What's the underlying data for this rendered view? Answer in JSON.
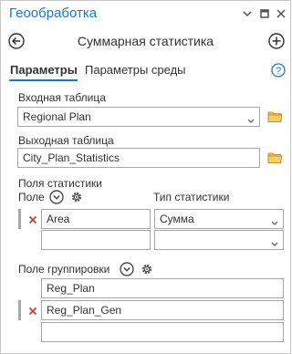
{
  "window": {
    "title": "Геообработка"
  },
  "tool": {
    "title": "Суммарная статистика"
  },
  "tabs": [
    {
      "label": "Параметры"
    },
    {
      "label": "Параметры среды"
    }
  ],
  "input_table": {
    "label": "Входная таблица",
    "value": "Regional Plan"
  },
  "output_table": {
    "label": "Выходная таблица",
    "value": "City_Plan_Statistics"
  },
  "statistics": {
    "section_label": "Поля статистики",
    "field_col_label": "Поле",
    "type_col_label": "Тип статистики",
    "rows": [
      {
        "field": "Area",
        "type": "Сумма"
      },
      {
        "field": "",
        "type": ""
      }
    ]
  },
  "group_by": {
    "label": "Поле группировки",
    "rows": [
      {
        "value": "Reg_Plan"
      },
      {
        "value": "Reg_Plan_Gen"
      },
      {
        "value": ""
      }
    ]
  },
  "colors": {
    "accent": "#1c79c2",
    "remove": "#c8372d",
    "folder": "#e8b84a"
  },
  "icons": {
    "back": "back-arrow-icon",
    "add": "plus-icon",
    "help": "help-icon",
    "options": "gear-icon",
    "folder": "folder-icon",
    "remove": "remove-x-icon"
  }
}
